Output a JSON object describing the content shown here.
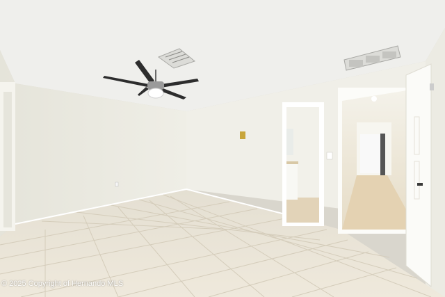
{
  "photo": {
    "watermark": "© 2025 Copyright of Hernando MLS",
    "colors": {
      "ceiling": "#efefec",
      "wall_left": "#ebeae1",
      "wall_back": "#f0efe8",
      "wall_right": "#ecebe3",
      "floor": "#ebe5d6",
      "grout": "#d6cfbe",
      "door": "#fbfbf8",
      "fan_blade": "#2d2d2d",
      "light_switch": "#c8a53a"
    }
  }
}
